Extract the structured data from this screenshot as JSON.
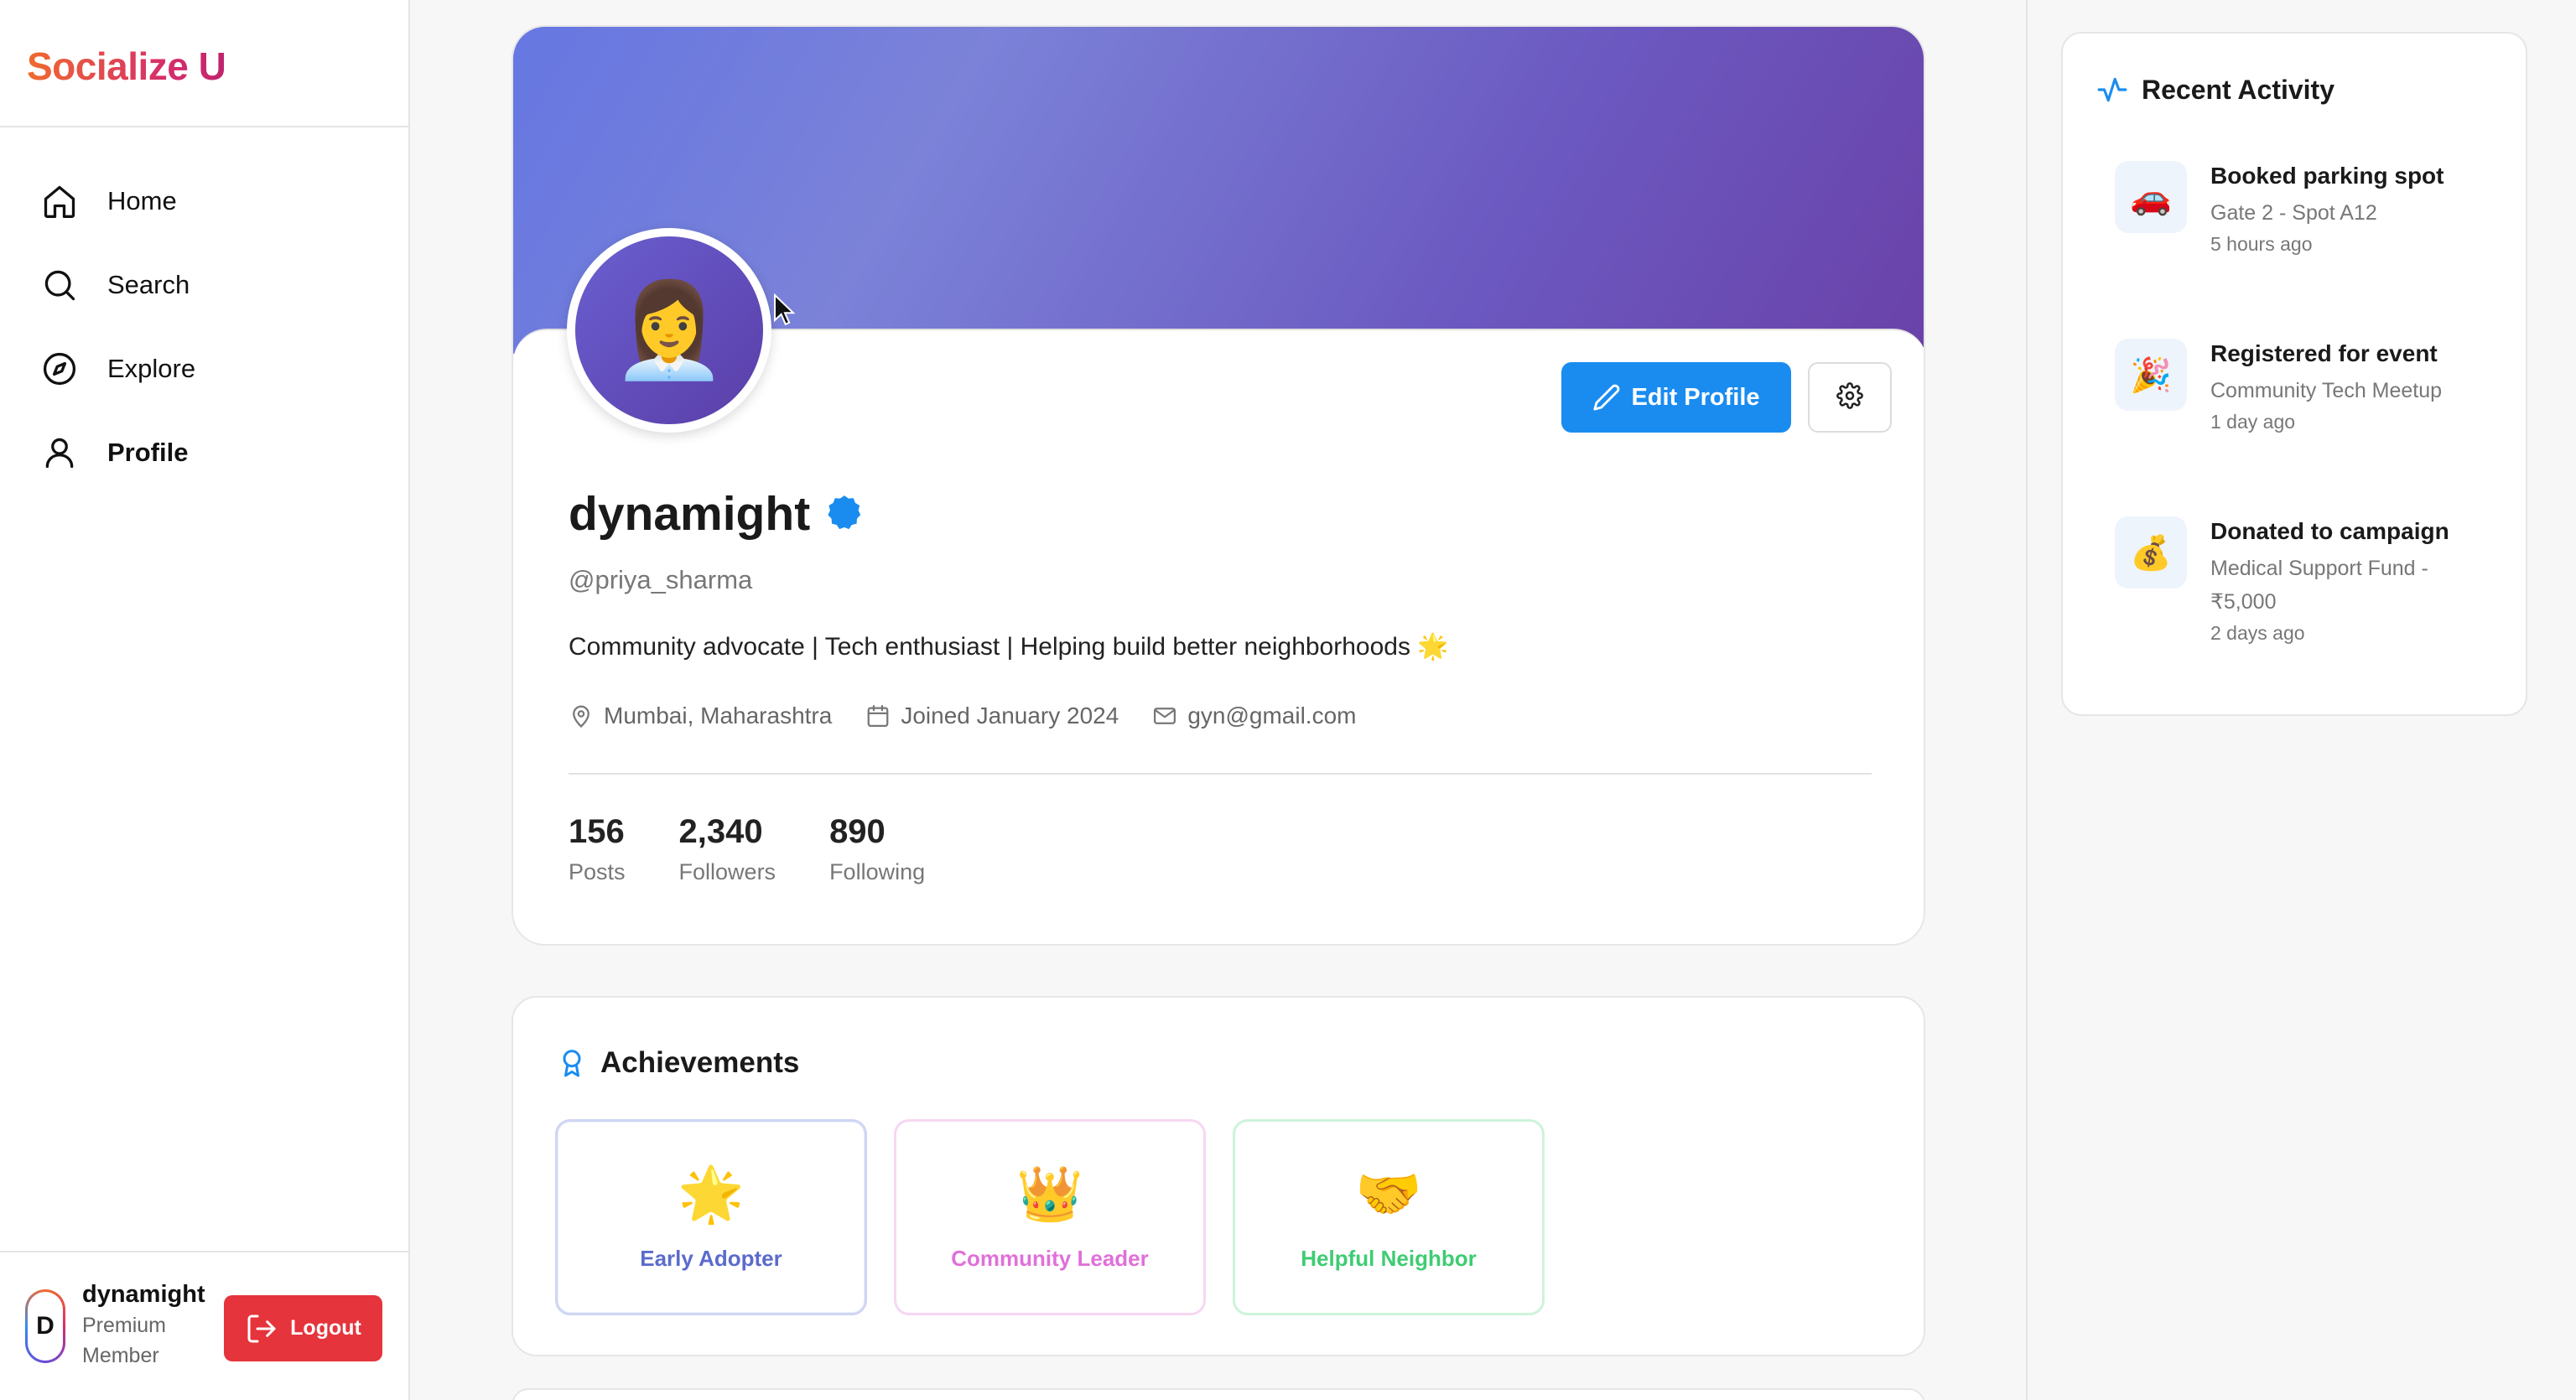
{
  "brand": "Socialize U",
  "nav": [
    {
      "label": "Home",
      "icon": "home-icon"
    },
    {
      "label": "Search",
      "icon": "search-icon"
    },
    {
      "label": "Explore",
      "icon": "compass-icon"
    },
    {
      "label": "Profile",
      "icon": "user-icon",
      "active": true
    }
  ],
  "sidebar_user": {
    "initial": "D",
    "name": "dynamight",
    "tier": "Premium Member",
    "logout_label": "Logout"
  },
  "profile": {
    "avatar_emoji": "👩‍💼",
    "display_name": "dynamight",
    "handle": "@priya_sharma",
    "bio": "Community advocate | Tech enthusiast | Helping build better neighborhoods 🌟",
    "location": "Mumbai, Maharashtra",
    "joined": "Joined January 2024",
    "email": "gyn@gmail.com",
    "edit_label": "Edit Profile",
    "stats": [
      {
        "value": "156",
        "label": "Posts"
      },
      {
        "value": "2,340",
        "label": "Followers"
      },
      {
        "value": "890",
        "label": "Following"
      }
    ]
  },
  "achievements": {
    "title": "Achievements",
    "badges": [
      {
        "emoji": "🌟",
        "label": "Early Adopter"
      },
      {
        "emoji": "👑",
        "label": "Community Leader"
      },
      {
        "emoji": "🤝",
        "label": "Helpful Neighbor"
      }
    ]
  },
  "recent_activity": {
    "title": "Recent Activity",
    "items": [
      {
        "emoji": "🚗",
        "title": "Booked parking spot",
        "subtitle": "Gate 2 - Spot A12",
        "time": "5 hours ago"
      },
      {
        "emoji": "🎉",
        "title": "Registered for event",
        "subtitle": "Community Tech Meetup",
        "time": "1 day ago"
      },
      {
        "emoji": "💰",
        "title": "Donated to campaign",
        "subtitle": "Medical Support Fund - ₹5,000",
        "time": "2 days ago"
      }
    ]
  },
  "colors": {
    "accent": "#1a8cf0",
    "logout": "#e5343b",
    "cover_start": "#6677e2",
    "cover_end": "#6a42a8"
  }
}
